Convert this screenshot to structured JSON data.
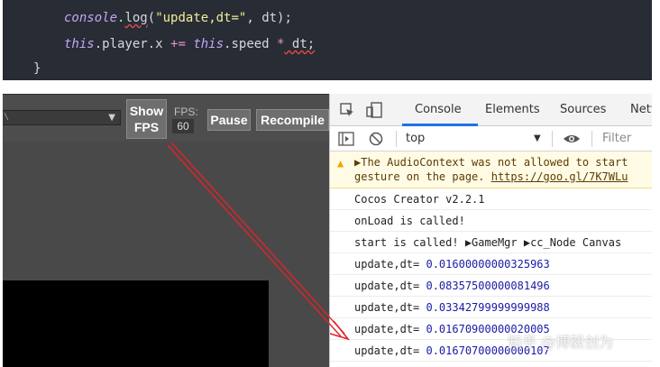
{
  "code": {
    "line1": {
      "obj": "console",
      "dot": ".",
      "method": "log",
      "open": "(",
      "str": "\"update,dt=\"",
      "rest": ", dt);"
    },
    "line2": {
      "kw1": "this",
      "a": ".player.x ",
      "op1": "+=",
      "sp": " ",
      "kw2": "this",
      "b": ".speed ",
      "op2": "*",
      "c": " dt;"
    },
    "line3": "}"
  },
  "preview": {
    "fps_button": {
      "line1": "Show",
      "line2": "FPS"
    },
    "fps_label": "FPS:",
    "fps_value": "60",
    "pause_label": "Pause",
    "recompile_label": "Recompile",
    "dropdown_edge": "\\"
  },
  "devtools": {
    "tabs": [
      "Console",
      "Elements",
      "Sources",
      "Netw"
    ],
    "context": "top",
    "filter_placeholder": "Filter",
    "warning": {
      "line1": "▶The AudioContext was not allowed to start",
      "line2_pre": "gesture on the page. ",
      "link": "https://goo.gl/7K7WLu"
    },
    "logs": [
      {
        "text": "Cocos Creator v2.2.1"
      },
      {
        "text": "onLoad is called!"
      },
      {
        "text": "start is called! ▶GameMgr ▶cc_Node Canvas"
      }
    ],
    "updates": [
      {
        "label": "update,dt= ",
        "value": "0.01600000000325963"
      },
      {
        "label": "update,dt= ",
        "value": "0.08357500000081496"
      },
      {
        "label": "update,dt= ",
        "value": "0.03342799999999988"
      },
      {
        "label": "update,dt= ",
        "value": "0.01670900000020005"
      },
      {
        "label": "update,dt= ",
        "value": "0.01670700000000107"
      }
    ]
  },
  "watermark": "知乎 @博毅创为",
  "colors": {
    "arrow": "#e0232b",
    "code_bg": "#282c34",
    "number": "#1a1aa6",
    "active_tab": "#1a73e8"
  }
}
